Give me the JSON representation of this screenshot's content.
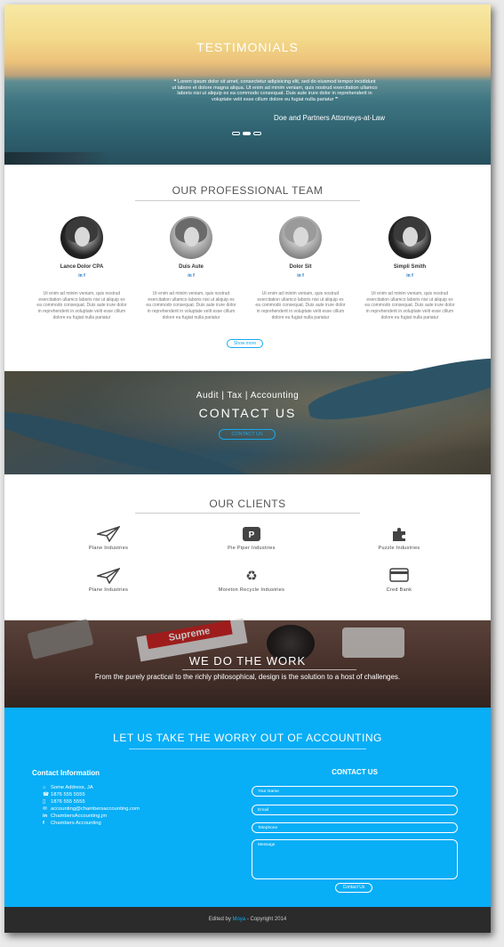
{
  "testimonials": {
    "title": "TESTIMONIALS",
    "quote": "Lorem ipsum dolor sit amet, consectetur adipisicing elit, sed do eiusmod tempor incididunt ut labore et dolore magna aliqua. Ut enim ad minim veniam, quis nostrud exercitation ullamco laboris nisi ut aliquip ex ea commodo consequat. Duis aute irure dolor in reprehenderit in voluptate velit esse cillum dolore eu fugiat nulla pariatur",
    "author": "Doe and Partners Attorneys-at-Law"
  },
  "team": {
    "title": "OUR PROFESSIONAL TEAM",
    "social": "in f",
    "description": "Ut enim ad minim veniam, quis nostrud exercitation ullamco laboris nisi ut aliquip ex ea commodo consequat. Duis aute irure dolor in reprehenderit in voluptate velit esse cillum dolore eu fugiat nulla pariatur",
    "members": [
      {
        "name": "Lance Dolor CPA"
      },
      {
        "name": "Duis Aute"
      },
      {
        "name": "Dolor Sit"
      },
      {
        "name": "Simpli Smith"
      }
    ],
    "show_more": "Show more"
  },
  "contact_banner": {
    "subtitle": "Audit | Tax | Accounting",
    "title": "CONTACT US",
    "button": "CONTACT US"
  },
  "clients": {
    "title": "OUR CLIENTS",
    "items": [
      {
        "label": "Plane Industries",
        "icon": "paper-plane-icon"
      },
      {
        "label": "Pie Piper Industries",
        "icon": "pied-piper-icon"
      },
      {
        "label": "Puzzle Industries",
        "icon": "puzzle-icon"
      },
      {
        "label": "Plane Industries",
        "icon": "paper-plane-icon"
      },
      {
        "label": "Moreton Recycle Industries",
        "icon": "recycle-icon"
      },
      {
        "label": "Cred Bank",
        "icon": "credit-card-icon"
      }
    ]
  },
  "work": {
    "title": "WE DO THE WORK",
    "tagline": "From the purely practical to the richly philosophical, design is the solution to a host of challenges."
  },
  "contact": {
    "heading": "LET US TAKE THE WORRY OUT OF ACCOUNTING",
    "info_title": "Contact Information",
    "info": [
      {
        "icon": "home-icon",
        "text": "Some Address, JA"
      },
      {
        "icon": "phone-icon",
        "text": "1876 555 5555"
      },
      {
        "icon": "mobile-icon",
        "text": "1876 555 5555"
      },
      {
        "icon": "envelope-icon",
        "text": "accounting@chambersaccounting.com"
      },
      {
        "icon": "linkedin-icon",
        "text": "ChambersAccounting.jm"
      },
      {
        "icon": "facebook-icon",
        "text": "Chambers Accounting"
      }
    ],
    "form_title": "CONTACT US",
    "name_placeholder": "Your Name",
    "email_placeholder": "Email",
    "phone_placeholder": "Telephone",
    "message_placeholder": "Message",
    "submit": "Contact Us"
  },
  "footer": {
    "prefix": "Edited by",
    "author": "Moya",
    "suffix": "- Copyright 2014"
  }
}
